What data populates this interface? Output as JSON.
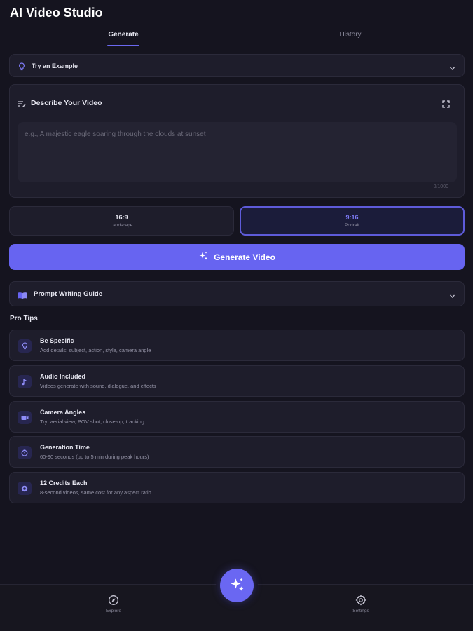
{
  "app": {
    "title": "AI Video Studio"
  },
  "tabs": [
    {
      "label": "Generate",
      "active": true
    },
    {
      "label": "History",
      "active": false
    }
  ],
  "example": {
    "label": "Try an Example",
    "icon": "lightbulb-icon"
  },
  "describe": {
    "label": "Describe Your Video",
    "icon": "edit-text-icon",
    "placeholder": "e.g., A majestic eagle soaring through the clouds at sunset",
    "value": "",
    "counter": "0/1000"
  },
  "aspect_ratios": [
    {
      "ratio": "16:9",
      "name": "Landscape",
      "selected": false
    },
    {
      "ratio": "9:16",
      "name": "Portrait",
      "selected": true
    }
  ],
  "generate_button": {
    "label": "Generate Video",
    "icon": "sparkles-icon"
  },
  "guide": {
    "label": "Prompt Writing Guide",
    "icon": "book-icon"
  },
  "pro_tips": {
    "title": "Pro Tips",
    "items": [
      {
        "title": "Be Specific",
        "desc": "Add details: subject, action, style, camera angle",
        "icon": "lightbulb-icon"
      },
      {
        "title": "Audio Included",
        "desc": "Videos generate with sound, dialogue, and effects",
        "icon": "music-note-icon"
      },
      {
        "title": "Camera Angles",
        "desc": "Try: aerial view, POV shot, close-up, tracking",
        "icon": "video-camera-icon"
      },
      {
        "title": "Generation Time",
        "desc": "60-90 seconds (up to 5 min during peak hours)",
        "icon": "timer-icon"
      },
      {
        "title": "12 Credits Each",
        "desc": "8-second videos, same cost for any aspect ratio",
        "icon": "coin-icon"
      }
    ]
  },
  "bottom_nav": {
    "explore": {
      "label": "Explore",
      "icon": "compass-icon"
    },
    "settings": {
      "label": "Settings",
      "icon": "gear-icon"
    },
    "fab_icon": "sparkles-icon"
  },
  "colors": {
    "background": "#15141f",
    "card": "#1e1d2b",
    "accent": "#6764f1",
    "accent_text": "#7d7af5"
  }
}
